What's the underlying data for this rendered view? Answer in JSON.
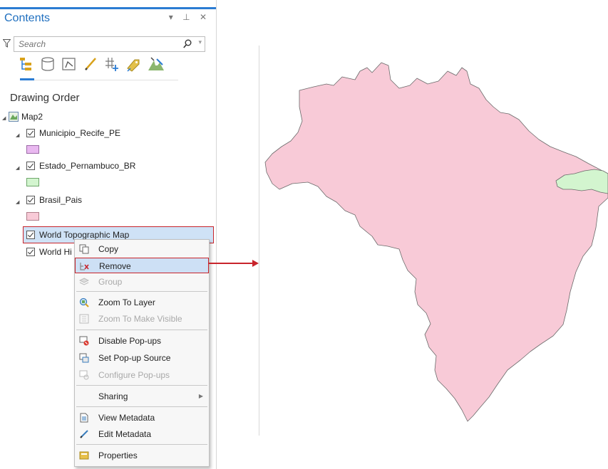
{
  "pane": {
    "title": "Contents",
    "controls": "▾ ⊥ ✕",
    "search_placeholder": "Search",
    "section_title": "Drawing Order"
  },
  "toolbar_icons": [
    "list-by-drawing-order-icon",
    "list-by-data-source-icon",
    "list-by-selection-icon",
    "list-by-editing-icon",
    "list-by-snapping-icon",
    "list-by-labeling-icon",
    "list-by-perspective-imagery-icon"
  ],
  "tree": {
    "map": "Map2",
    "layers": [
      {
        "name": "Municipio_Recife_PE",
        "swatch": "#e9b8f0",
        "swatch_border": "#9b6aa6"
      },
      {
        "name": "Estado_Pernambuco_BR",
        "swatch": "#d3f5cf",
        "swatch_border": "#6ea66a"
      },
      {
        "name": "Brasil_Pais",
        "swatch": "#f8cad7",
        "swatch_border": "#b07e8a"
      }
    ],
    "basemaps": [
      "World Topographic Map",
      "World Hi"
    ]
  },
  "context_menu": {
    "copy": "Copy",
    "remove": "Remove",
    "group": "Group",
    "zoom_to_layer": "Zoom To Layer",
    "zoom_to_make_visible": "Zoom To Make Visible",
    "disable_popups": "Disable Pop-ups",
    "set_popup_source": "Set Pop-up Source",
    "configure_popups": "Configure Pop-ups",
    "sharing": "Sharing",
    "view_metadata": "View Metadata",
    "edit_metadata": "Edit Metadata",
    "properties": "Properties"
  },
  "colors": {
    "accent": "#2b7cd3",
    "highlight": "#cde0f5",
    "callout_red": "#c8242b",
    "brazil_fill": "#f8cad7",
    "pernambuco_fill": "#d3f5cf"
  }
}
